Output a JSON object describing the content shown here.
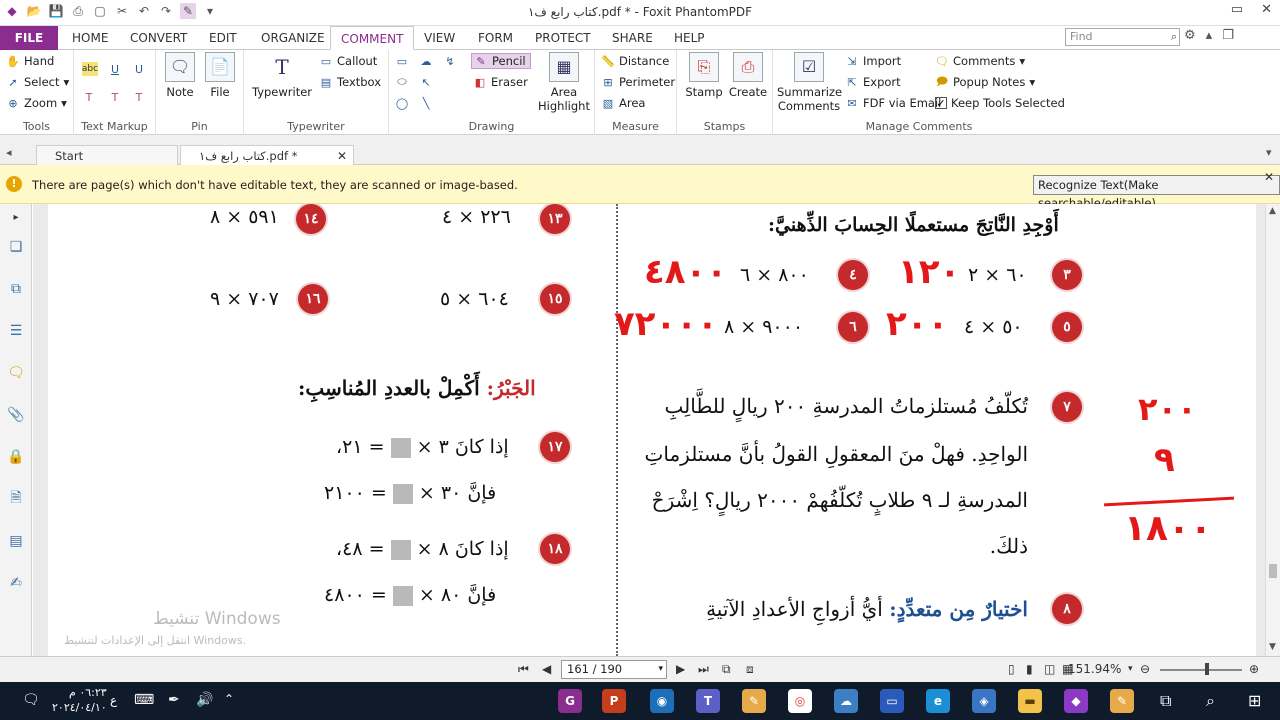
{
  "window": {
    "title": "كتاب رابع ف١.pdf * - Foxit PhantomPDF",
    "minimize": "▭",
    "close": "✕"
  },
  "ribbon_tabs": [
    "FILE",
    "HOME",
    "CONVERT",
    "EDIT",
    "ORGANIZE",
    "COMMENT",
    "VIEW",
    "FORM",
    "PROTECT",
    "SHARE",
    "HELP"
  ],
  "active_tab": "COMMENT",
  "find": {
    "placeholder": "Find"
  },
  "ribbon": {
    "tools": {
      "label": "Tools",
      "hand": "Hand",
      "select": "Select",
      "zoom": "Zoom"
    },
    "text_markup": {
      "label": "Text Markup"
    },
    "pin": {
      "label": "Pin",
      "note": "Note",
      "file": "File"
    },
    "typewriter": {
      "label": "Typewriter",
      "typewriter": "Typewriter",
      "callout": "Callout",
      "textbox": "Textbox"
    },
    "drawing": {
      "label": "Drawing",
      "pencil": "Pencil",
      "eraser": "Eraser",
      "area_highlight_1": "Area",
      "area_highlight_2": "Highlight"
    },
    "measure": {
      "label": "Measure",
      "distance": "Distance",
      "perimeter": "Perimeter",
      "area": "Area"
    },
    "stamps": {
      "label": "Stamps",
      "stamp": "Stamp",
      "create": "Create"
    },
    "manage": {
      "label": "Manage Comments",
      "summarize_1": "Summarize",
      "summarize_2": "Comments",
      "import": "Import",
      "export": "Export",
      "fdf_email": "FDF via Email",
      "comments": "Comments",
      "popup_notes": "Popup Notes",
      "keep_tools": "Keep Tools Selected"
    }
  },
  "doc_tabs": {
    "start": "Start",
    "file": "كتاب رابع ف١.pdf *"
  },
  "notice": {
    "text": "There are page(s) which don't have editable text, they are scanned or image-based.",
    "button": "Recognize Text(Make searchable/editable)"
  },
  "page": {
    "right": {
      "instruction": "أَوْجِدِ النَّاتِجَ مستعملًا الحِسابَ الذِّهنيَّ:",
      "n3": "٣",
      "p3": "٦٠ × ٢",
      "n4": "٤",
      "p4": "٨٠٠ × ٦",
      "n5": "٥",
      "p5": "٥٠ × ٤",
      "n6": "٦",
      "p6": "٩٠٠٠ × ٨",
      "n7": "٧",
      "q7_l1": "تُكلّفُ مُستلزماتُ المدرسةِ ٢٠٠ ريالٍ للطَّالِبِ",
      "q7_l2": "الواحِدِ. فهلْ منَ المعقولِ القولُ بأنَّ مستلزماتِ",
      "q7_l3": "المدرسةِ لـ ٩ طلابٍ تُكلّفُهمْ ٢٠٠٠ ريالٍ؟ اِشْرَحْ",
      "q7_l4": "ذلكَ.",
      "n8": "٨",
      "q8_lead": "اختيارٌ مِن متعدِّدٍ:",
      "q8_text": "أيُّ أزواجِ الأعدادِ الآتيةِ"
    },
    "left": {
      "n13": "١٣",
      "p13": "٢٢٦ × ٤",
      "n14": "١٤",
      "p14": "٥٩١ × ٨",
      "n15": "١٥",
      "p15": "٦٠٤ × ٥",
      "n16": "١٦",
      "p16": "٧٠٧ × ٩",
      "algebra_lead": "الجَبْرُ:",
      "algebra_text": "أَكْمِلْ بالعددِ المُناسِبِ:",
      "n17": "١٧",
      "q17_a_pre": "إذا كانَ ٣ ×",
      "q17_a_post": "= ٢١،",
      "q17_b_pre": "فإنَّ ٣٠ ×",
      "q17_b_post": "= ٢١٠٠",
      "n18": "١٨",
      "q18_a_pre": "إذا كانَ ٨ ×",
      "q18_a_post": "= ٤٨،",
      "q18_b_pre": "فإنَّ ٨٠ ×",
      "q18_b_post": "= ٤٨٠٠"
    },
    "handwriting": {
      "a3": "١٢٠",
      "a4": "٤٨٠٠",
      "a5": "٢٠٠",
      "a6": "٧٢٠٠٠",
      "calc1": "٢٠٠",
      "calc2": "٩",
      "calc3": "١٨٠٠"
    },
    "watermark": {
      "line1": "تنشيط Windows",
      "line2": "انتقل إلى الإعدادات لتنشيط Windows."
    }
  },
  "status": {
    "page_field": "161 / 190",
    "zoom": "151.94%"
  },
  "taskbar": {
    "time": "٠٦:٢٣ م",
    "date": "٢٠٢٤/٠٤/١٠",
    "lang": "ع"
  },
  "colors": {
    "accent": "#8b2c8f",
    "badge": "#c4292c",
    "ink": "#e31919",
    "notice_bg": "#fff8c9"
  }
}
